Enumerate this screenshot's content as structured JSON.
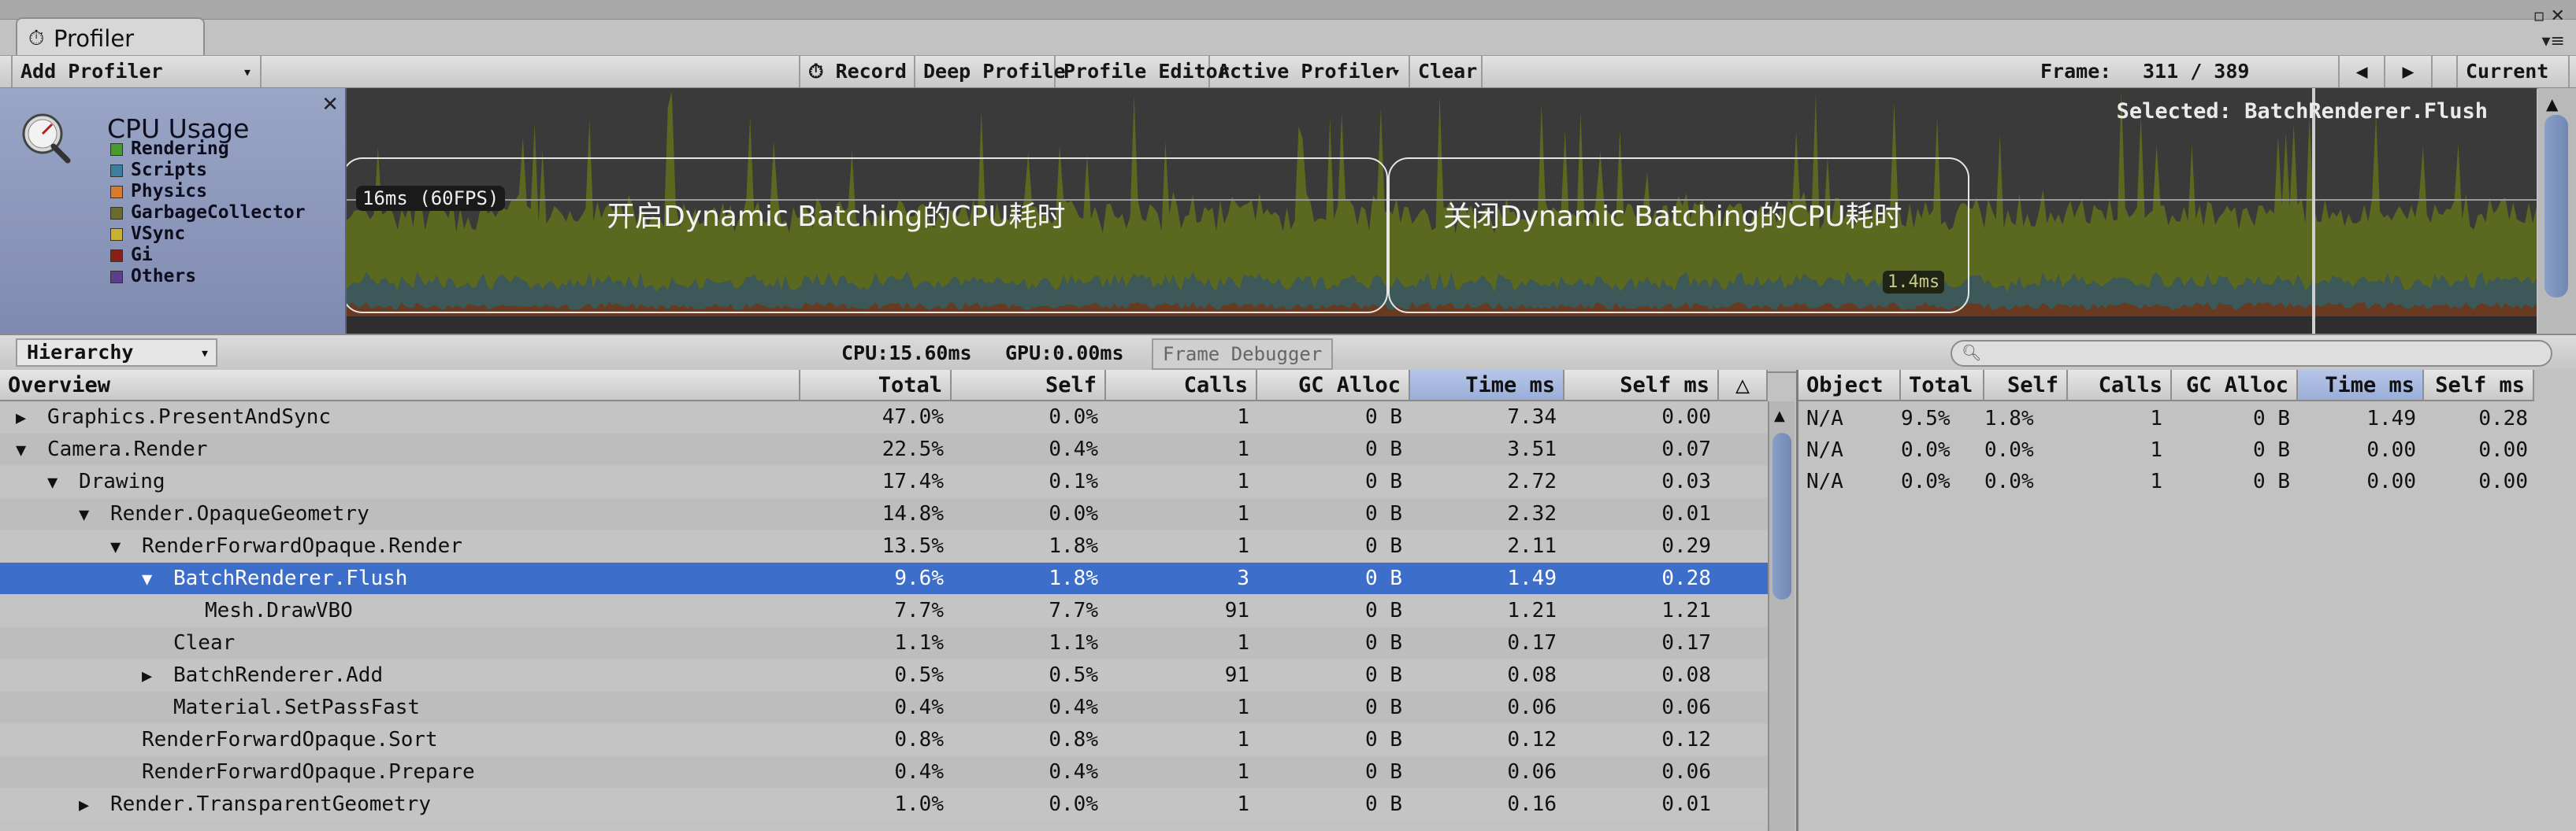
{
  "window": {
    "tab_title": "Profiler",
    "tab_icon": "profiler-clock-icon",
    "controls": "▫ ✕",
    "menu": "▾≡"
  },
  "toolbar": {
    "add_profiler": "Add Profiler",
    "record": "Record",
    "record_icon": "record-clock-icon",
    "deep_profile": "Deep Profile",
    "profile_editor": "Profile Editor",
    "active_profiler": "Active Profiler",
    "clear": "Clear",
    "frame_label": "Frame:",
    "frame_value": "311 / 389",
    "prev": "◀",
    "next": "▶",
    "current": "Current"
  },
  "cpu_module": {
    "title": "CPU Usage",
    "icon": "cpu-usage-gauge-icon",
    "legend": [
      {
        "label": "Rendering",
        "color": "#4a9b2f"
      },
      {
        "label": "Scripts",
        "color": "#3a7fa0"
      },
      {
        "label": "Physics",
        "color": "#d77c2c"
      },
      {
        "label": "GarbageCollector",
        "color": "#6b6b2a"
      },
      {
        "label": "VSync",
        "color": "#c9b22f"
      },
      {
        "label": "Gi",
        "color": "#8a1f18"
      },
      {
        "label": "Others",
        "color": "#5b3e8c"
      }
    ],
    "selected_label": "Selected: BatchRenderer.Flush",
    "fps_marker": "16ms (60FPS)",
    "cursor_value": "1.4ms",
    "annotation_left": "开启Dynamic Batching的CPU耗时",
    "annotation_right": "关闭Dynamic Batching的CPU耗时"
  },
  "hierarchy_bar": {
    "view_mode": "Hierarchy",
    "cpu_time": "CPU:15.60ms",
    "gpu_time": "GPU:0.00ms",
    "frame_debugger": "Frame Debugger"
  },
  "tree_table": {
    "columns": [
      "Overview",
      "Total",
      "Self",
      "Calls",
      "GC Alloc",
      "Time ms",
      "Self ms"
    ],
    "sorted_column": "Time ms",
    "rows": [
      {
        "name": "Graphics.PresentAndSync",
        "depth": 0,
        "arrow": "▶",
        "total": "47.0%",
        "self": "0.0%",
        "calls": "1",
        "gc": "0 B",
        "time": "7.34",
        "selfms": "0.00"
      },
      {
        "name": "Camera.Render",
        "depth": 0,
        "arrow": "▼",
        "total": "22.5%",
        "self": "0.4%",
        "calls": "1",
        "gc": "0 B",
        "time": "3.51",
        "selfms": "0.07"
      },
      {
        "name": "Drawing",
        "depth": 1,
        "arrow": "▼",
        "total": "17.4%",
        "self": "0.1%",
        "calls": "1",
        "gc": "0 B",
        "time": "2.72",
        "selfms": "0.03"
      },
      {
        "name": "Render.OpaqueGeometry",
        "depth": 2,
        "arrow": "▼",
        "total": "14.8%",
        "self": "0.0%",
        "calls": "1",
        "gc": "0 B",
        "time": "2.32",
        "selfms": "0.01"
      },
      {
        "name": "RenderForwardOpaque.Render",
        "depth": 3,
        "arrow": "▼",
        "total": "13.5%",
        "self": "1.8%",
        "calls": "1",
        "gc": "0 B",
        "time": "2.11",
        "selfms": "0.29"
      },
      {
        "name": "BatchRenderer.Flush",
        "depth": 4,
        "arrow": "▼",
        "total": "9.6%",
        "self": "1.8%",
        "calls": "3",
        "gc": "0 B",
        "time": "1.49",
        "selfms": "0.28",
        "selected": true
      },
      {
        "name": "Mesh.DrawVBO",
        "depth": 5,
        "arrow": "",
        "total": "7.7%",
        "self": "7.7%",
        "calls": "91",
        "gc": "0 B",
        "time": "1.21",
        "selfms": "1.21"
      },
      {
        "name": "Clear",
        "depth": 4,
        "arrow": "",
        "total": "1.1%",
        "self": "1.1%",
        "calls": "1",
        "gc": "0 B",
        "time": "0.17",
        "selfms": "0.17"
      },
      {
        "name": "BatchRenderer.Add",
        "depth": 4,
        "arrow": "▶",
        "total": "0.5%",
        "self": "0.5%",
        "calls": "91",
        "gc": "0 B",
        "time": "0.08",
        "selfms": "0.08"
      },
      {
        "name": "Material.SetPassFast",
        "depth": 4,
        "arrow": "",
        "total": "0.4%",
        "self": "0.4%",
        "calls": "1",
        "gc": "0 B",
        "time": "0.06",
        "selfms": "0.06"
      },
      {
        "name": "RenderForwardOpaque.Sort",
        "depth": 3,
        "arrow": "",
        "total": "0.8%",
        "self": "0.8%",
        "calls": "1",
        "gc": "0 B",
        "time": "0.12",
        "selfms": "0.12"
      },
      {
        "name": "RenderForwardOpaque.Prepare",
        "depth": 3,
        "arrow": "",
        "total": "0.4%",
        "self": "0.4%",
        "calls": "1",
        "gc": "0 B",
        "time": "0.06",
        "selfms": "0.06"
      },
      {
        "name": "Render.TransparentGeometry",
        "depth": 2,
        "arrow": "▶",
        "total": "1.0%",
        "self": "0.0%",
        "calls": "1",
        "gc": "0 B",
        "time": "0.16",
        "selfms": "0.01"
      }
    ]
  },
  "object_table": {
    "columns": [
      "Object",
      "Total",
      "Self",
      "Calls",
      "GC Alloc",
      "Time ms",
      "Self ms"
    ],
    "sorted_column": "Time ms",
    "rows": [
      {
        "object": "N/A",
        "total": "9.5%",
        "self": "1.8%",
        "calls": "1",
        "gc": "0 B",
        "time": "1.49",
        "selfms": "0.28"
      },
      {
        "object": "N/A",
        "total": "0.0%",
        "self": "0.0%",
        "calls": "1",
        "gc": "0 B",
        "time": "0.00",
        "selfms": "0.00"
      },
      {
        "object": "N/A",
        "total": "0.0%",
        "self": "0.0%",
        "calls": "1",
        "gc": "0 B",
        "time": "0.00",
        "selfms": "0.00"
      }
    ]
  }
}
